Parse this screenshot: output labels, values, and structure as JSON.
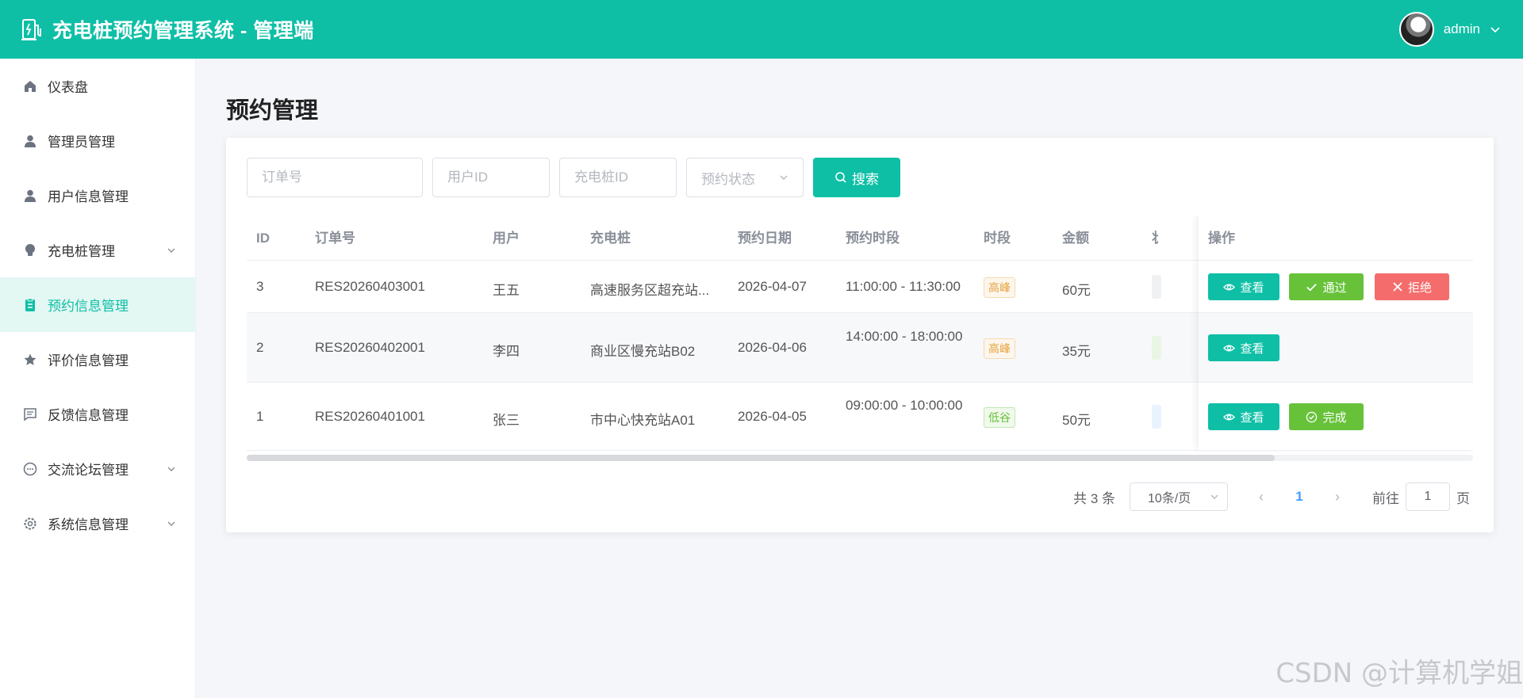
{
  "header": {
    "title": "充电桩预约管理系统 - 管理端",
    "user_name": "admin"
  },
  "sidebar": {
    "items": [
      {
        "label": "仪表盘",
        "icon": "home-icon"
      },
      {
        "label": "管理员管理",
        "icon": "user-icon"
      },
      {
        "label": "用户信息管理",
        "icon": "user-icon"
      },
      {
        "label": "充电桩管理",
        "icon": "bulb-icon"
      },
      {
        "label": "预约信息管理",
        "icon": "clipboard-icon"
      },
      {
        "label": "评价信息管理",
        "icon": "star-icon"
      },
      {
        "label": "反馈信息管理",
        "icon": "message-icon"
      },
      {
        "label": "交流论坛管理",
        "icon": "chat-icon"
      },
      {
        "label": "系统信息管理",
        "icon": "gear-icon"
      }
    ],
    "active_label": "预约信息管理",
    "accent_color": "#0ebfa6"
  },
  "main": {
    "page_title": "预约管理",
    "filters": {
      "order_no_placeholder": "订单号",
      "user_id_placeholder": "用户ID",
      "pile_id_placeholder": "充电桩ID",
      "status_placeholder": "预约状态",
      "search_label": "搜索"
    },
    "table": {
      "columns": [
        "ID",
        "订单号",
        "用户",
        "充电桩",
        "预约日期",
        "预约时段",
        "时段",
        "金额",
        "状",
        "操作"
      ],
      "rows": [
        {
          "id": "3",
          "order_no": "RES20260403001",
          "user": "王五",
          "pile": "高速服务区超充站...",
          "date": "2026-04-07",
          "slot": "11:00:00 - 11:30:00",
          "period": "高峰",
          "amount": "60元",
          "actions": [
            "查看",
            "通过",
            "拒绝"
          ]
        },
        {
          "id": "2",
          "order_no": "RES20260402001",
          "user": "李四",
          "pile": "商业区慢充站B02",
          "date": "2026-04-06",
          "slot": "14:00:00 - 18:00:00",
          "period": "高峰",
          "amount": "35元",
          "actions": [
            "查看"
          ]
        },
        {
          "id": "1",
          "order_no": "RES20260401001",
          "user": "张三",
          "pile": "市中心快充站A01",
          "date": "2026-04-05",
          "slot": "09:00:00 - 10:00:00",
          "period": "低谷",
          "amount": "50元",
          "actions": [
            "查看",
            "完成"
          ]
        }
      ]
    },
    "pagination": {
      "total": "共 3 条",
      "page_size": "10条/页",
      "current_page": "1",
      "goto_label": "前往",
      "goto_value": "1",
      "goto_suffix": "页"
    }
  },
  "watermark": "CSDN @计算机学姐"
}
